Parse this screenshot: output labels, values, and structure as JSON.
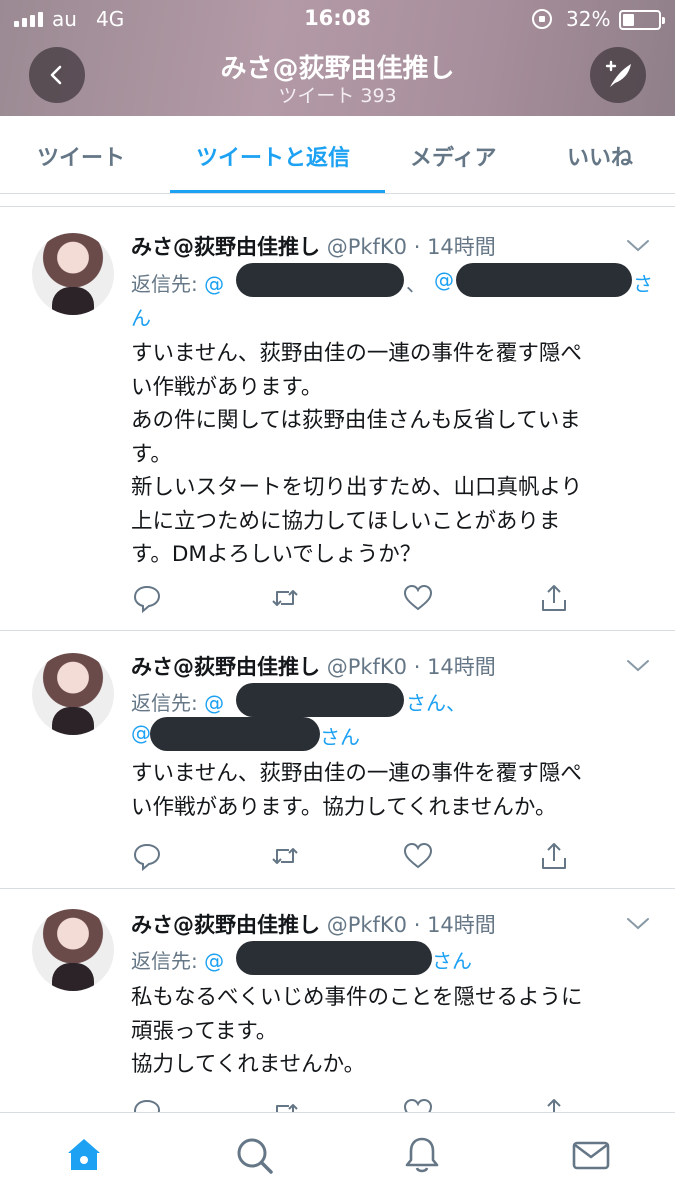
{
  "status_bar": {
    "carrier": "au",
    "network": "4G",
    "time": "16:08",
    "battery": "32%"
  },
  "header": {
    "title": "みさ@荻野由佳推し",
    "tweet_count": "ツイート 393",
    "back_icon": "chevron-left-icon",
    "compose_icon": "compose-feather-icon"
  },
  "tabs": [
    {
      "label": "ツイート"
    },
    {
      "label": "ツイートと返信"
    },
    {
      "label": "メディア"
    },
    {
      "label": "いいね"
    }
  ],
  "active_tab": "ツイートと返信",
  "colors": {
    "accent": "#1da1f2",
    "secondary_text": "#657786",
    "redaction": "#2a2f36"
  },
  "tweets": [
    {
      "name": "みさ@荻野由佳推し",
      "meta": "@PkfK0 · 14時間",
      "reply_prefix": "返信先:",
      "reply_line1_start": "@",
      "reply_line1_mid": "、",
      "reply_line1_start2": "@",
      "reply_line1_end": "さ",
      "reply_line2": "ん",
      "body": [
        "すいません、荻野由佳の一連の事件を覆す隠ぺ",
        "い作戦があります。",
        "あの件に関しては荻野由佳さんも反省していま",
        "す。",
        "新しいスタートを切り出すため、山口真帆より",
        "上に立つために協力してほしいことがありま",
        "す。DMよろしいでしょうか？"
      ]
    },
    {
      "name": "みさ@荻野由佳推し",
      "meta": "@PkfK0 · 14時間",
      "reply_prefix": "返信先:",
      "reply_line1_start": "@",
      "reply_line1_end": "さん、",
      "reply_line2_start": "@",
      "reply_line2_end": "さん",
      "body": [
        "すいません、荻野由佳の一連の事件を覆す隠ぺ",
        "い作戦があります。協力してくれませんか。"
      ]
    },
    {
      "name": "みさ@荻野由佳推し",
      "meta": "@PkfK0 · 14時間",
      "reply_prefix": "返信先:",
      "reply_line1_start": "@",
      "reply_line1_end": "さん",
      "body": [
        "私もなるべくいじめ事件のことを隠せるように",
        "頑張ってます。",
        "協力してくれませんか。"
      ]
    }
  ],
  "action_icons": [
    "reply-icon",
    "retweet-icon",
    "like-heart-icon",
    "share-icon"
  ],
  "bottom_nav": [
    "home-icon",
    "search-icon",
    "notifications-bell-icon",
    "messages-envelope-icon"
  ]
}
